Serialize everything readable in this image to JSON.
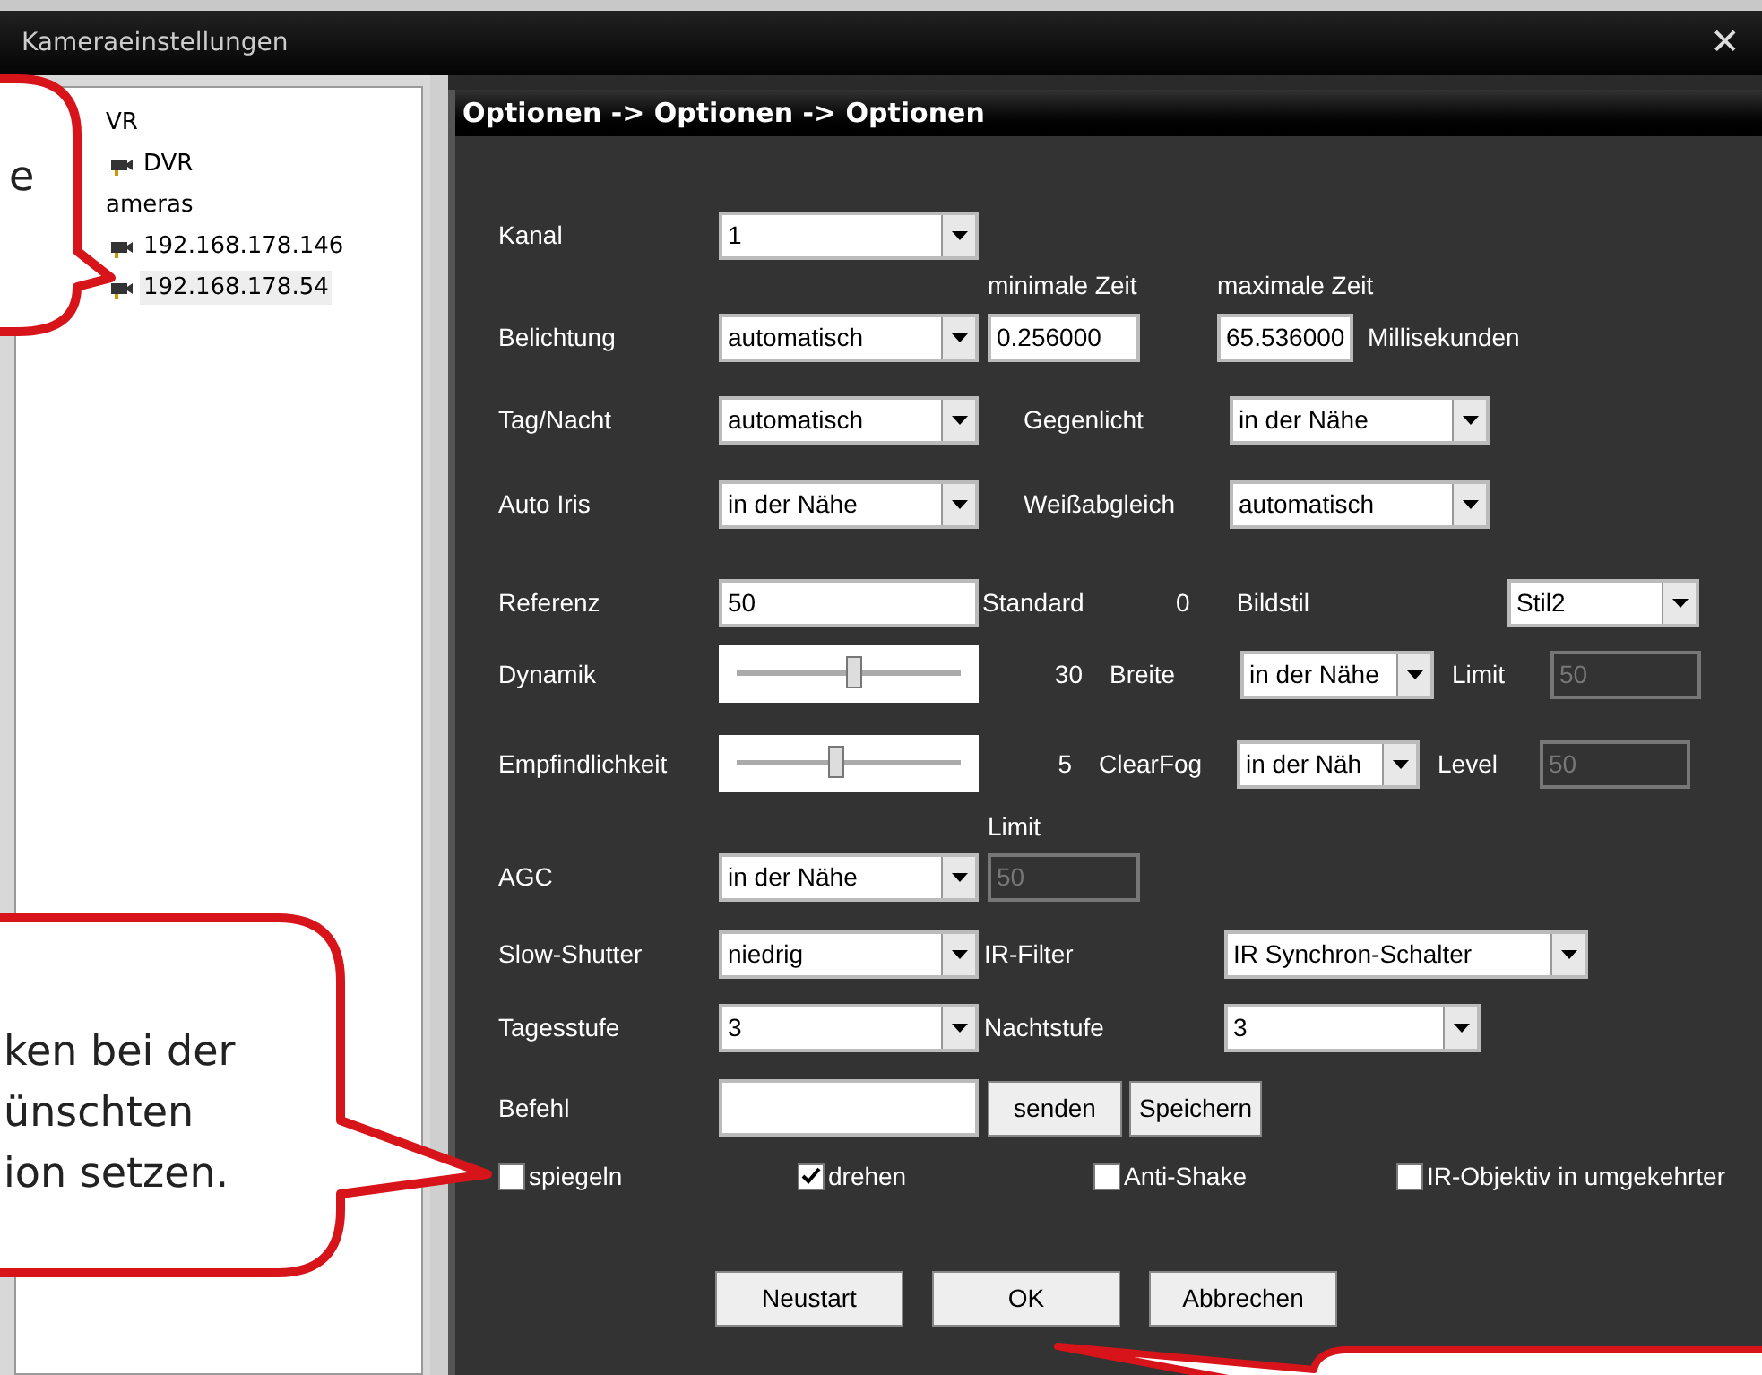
{
  "window": {
    "title": "Kameraeinstellungen",
    "close": "✕"
  },
  "tree": {
    "items": [
      {
        "label": "VR",
        "selected": false,
        "children": [
          {
            "label": "DVR",
            "selected": false
          }
        ]
      },
      {
        "label": "ameras",
        "selected": false,
        "children": [
          {
            "label": "192.168.178.146",
            "selected": false
          },
          {
            "label": "192.168.178.54",
            "selected": true
          }
        ]
      }
    ]
  },
  "panel": {
    "title": "Optionen -> Optionen -> Optionen"
  },
  "form": {
    "kanal": {
      "label": "Kanal",
      "value": "1"
    },
    "min_label": "minimale Zeit",
    "max_label": "maximale Zeit",
    "belichtung": {
      "label": "Belichtung",
      "value": "automatisch",
      "min": "0.256000",
      "max": "65.536000",
      "unit": "Millisekunden"
    },
    "tag_nacht": {
      "label": "Tag/Nacht",
      "value": "automatisch",
      "label_2": "Gegenlicht",
      "value_2": "in der Nähe"
    },
    "auto_iris": {
      "label": "Auto Iris",
      "value": "in der Nähe",
      "label_2": "Weißabgleich",
      "value_2": "automatisch"
    },
    "referenz": {
      "label": "Referenz",
      "value": "50",
      "standard_label": "Standard",
      "standard_value": "0",
      "label_2": "Bildstil",
      "value_2": "Stil2"
    },
    "dynamik": {
      "label": "Dynamik",
      "level": 0.52,
      "reading": "30",
      "label_2": "Breite",
      "value_2": "in der Nähe",
      "label_3": "Limit",
      "value_3": "50",
      "disabled_3": true
    },
    "empfindlichkeit": {
      "label": "Empfindlichkeit",
      "level": 0.44,
      "reading": "5",
      "label_2": "ClearFog",
      "value_2": "in der Näh",
      "label_3": "Level",
      "value_3": "50",
      "disabled_3": true
    },
    "agc_limit_label": "Limit",
    "agc": {
      "label": "AGC",
      "value": "in der Nähe",
      "limit": "50",
      "disabled": true
    },
    "slow_shutter": {
      "label": "Slow-Shutter",
      "value": "niedrig",
      "label_2": "IR-Filter",
      "value_2": "IR Synchron-Schalter"
    },
    "tagesstufe": {
      "label": "Tagesstufe",
      "value": "3",
      "label_2": "Nachtstufe",
      "value_2": "3"
    },
    "befehl": {
      "label": "Befehl",
      "send": "senden",
      "save": "Speichern"
    },
    "checkboxes": [
      {
        "label": "spiegeln",
        "checked": false
      },
      {
        "label": "drehen",
        "checked": true
      },
      {
        "label": "Anti-Shake",
        "checked": false
      },
      {
        "label": "IR-Objektiv in umgekehrter",
        "checked": false
      }
    ],
    "buttons": [
      "Neustart",
      "OK",
      "Abbrechen"
    ]
  },
  "callouts": [
    {
      "text": "e"
    },
    {
      "text": "ken bei der\nünschten\nion setzen."
    }
  ]
}
